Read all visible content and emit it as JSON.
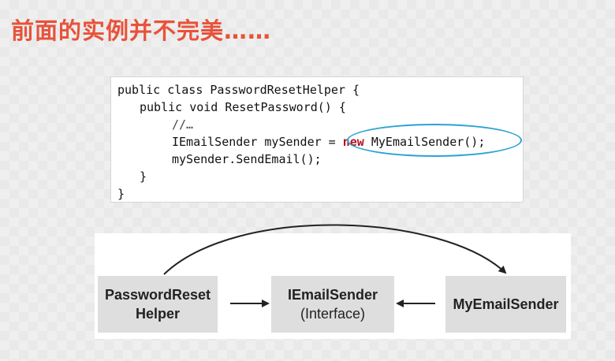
{
  "title": "前面的实例并不完美……",
  "code": {
    "line1": "public class PasswordResetHelper {",
    "line2": "public void ResetPassword() {",
    "line3": "//…",
    "line4_pre": "IEmailSender mySender = ",
    "line4_kw": "new",
    "line4_post": " MyEmailSender();",
    "line5": "mySender.SendEmail();",
    "line6": "}",
    "line7": "}"
  },
  "nodes": {
    "helper": {
      "line1": "PasswordReset",
      "line2": "Helper"
    },
    "interface": {
      "line1": "IEmailSender",
      "line2": "(Interface)"
    },
    "impl": {
      "label": "MyEmailSender"
    }
  },
  "colors": {
    "title": "#e8523a",
    "keyword": "#b3121f",
    "highlight": "#2aa3d5",
    "node_fill": "#dedede"
  }
}
